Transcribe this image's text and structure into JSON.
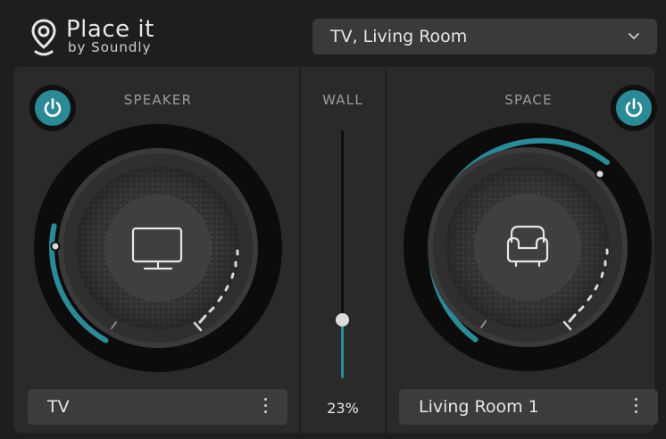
{
  "brand": {
    "name": "Place it",
    "tagline": "by Soundly"
  },
  "room_select": {
    "value": "TV, Living Room"
  },
  "speaker": {
    "label": "SPEAKER",
    "power": "on",
    "preset": "TV"
  },
  "wall": {
    "label": "WALL",
    "value_label": "23%",
    "value": 0.23
  },
  "space": {
    "label": "SPACE",
    "power": "on",
    "preset": "Living Room 1"
  },
  "colors": {
    "accent": "#2b8a96",
    "panel": "#2a2a2b",
    "background": "#1e1e1f"
  },
  "icons": {
    "speaker_center": "tv-icon",
    "space_center": "armchair-icon",
    "power": "power-icon",
    "dropdown": "chevron-down-icon",
    "menu": "more-vertical-icon",
    "logo": "location-pin-icon"
  }
}
